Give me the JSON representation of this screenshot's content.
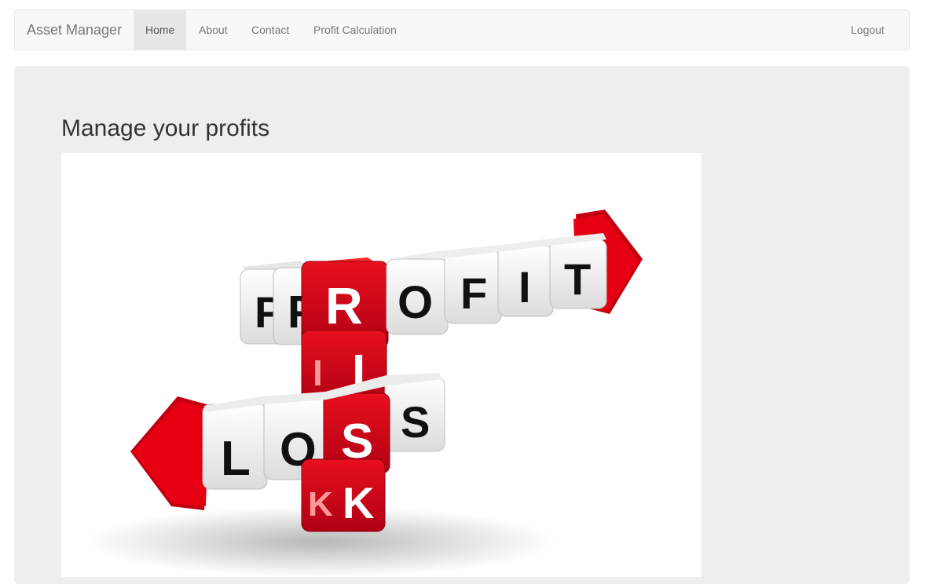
{
  "navbar": {
    "brand": "Asset Manager",
    "items": [
      {
        "label": "Home",
        "active": true
      },
      {
        "label": "About",
        "active": false
      },
      {
        "label": "Contact",
        "active": false
      },
      {
        "label": "Profit Calculation",
        "active": false
      }
    ],
    "logout_label": "Logout"
  },
  "main": {
    "title": "Manage your profits",
    "image": {
      "subject": "letter cubes crossword with arrows",
      "words": [
        "PROFIT",
        "RISK",
        "LOSS"
      ],
      "colors": {
        "cube_red": "#d0021b",
        "cube_white": "#f2f2f2",
        "arrow_red": "#e10000",
        "letter_black": "#111111",
        "letter_white": "#ffffff"
      }
    }
  },
  "colors": {
    "navbar_bg": "#f8f8f8",
    "navbar_border": "#e7e7e7",
    "active_item_bg": "#e7e7e7",
    "jumbotron_bg": "#eeeeee"
  }
}
